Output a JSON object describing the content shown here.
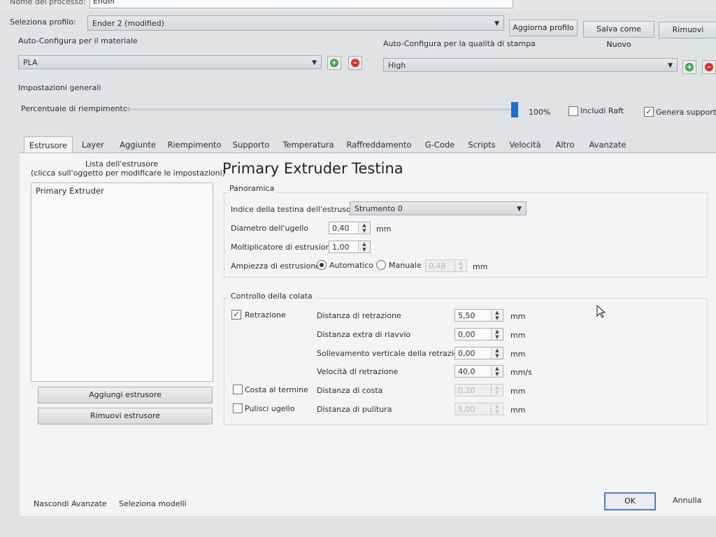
{
  "header": {
    "process_name_label": "Nome del processo:",
    "process_name_value": "Ender",
    "profile_label": "Seleziona profilo:",
    "profile_value": "Ender 2 (modified)",
    "update_profile": "Aggiorna profilo",
    "save_new": "Salva come Nuovo",
    "remove": "Rimuovi"
  },
  "material": {
    "label": "Auto-Configura per il materiale",
    "value": "PLA"
  },
  "quality": {
    "label": "Auto-Configura per la qualità di stampa",
    "value": "High"
  },
  "general": {
    "title": "Impostazioni generali",
    "infill_label": "Percentuale di riempimento:",
    "infill_value": "100%",
    "infill_fraction": 1.0,
    "raft_label": "Includi Raft",
    "raft_checked": false,
    "support_label": "Genera supporto",
    "support_checked": true
  },
  "tabs": [
    "Estrusore",
    "Layer",
    "Aggiunte",
    "Riempimento",
    "Supporto",
    "Temperatura",
    "Raffreddamento",
    "G-Code",
    "Scripts",
    "Velocità",
    "Altro",
    "Avanzate"
  ],
  "extruder_list": {
    "title": "Lista dell'estrusore",
    "subtitle": "(clicca sull'oggetto per modificare le impostazioni)",
    "items": [
      "Primary Extruder"
    ],
    "add_button": "Aggiungi estrusore",
    "remove_button": "Rimuovi estrusore"
  },
  "extruder": {
    "heading": "Primary Extruder Testina",
    "overview_title": "Panoramica",
    "head_index_label": "Indice della testina dell'estrusore",
    "head_index_value": "Strumento 0",
    "nozzle_label": "Diametro dell'ugello",
    "nozzle_value": "0,40",
    "nozzle_unit": "mm",
    "multiplier_label": "Moltiplicatore di estrusione",
    "multiplier_value": "1,00",
    "width_label": "Ampiezza di estrusione",
    "width_auto": "Automatico",
    "width_manual": "Manuale",
    "width_value": "0,48",
    "width_unit": "mm"
  },
  "ooze": {
    "title": "Controllo della colata",
    "retraction_label": "Retrazione",
    "retraction_checked": true,
    "coast_label": "Costa al termine",
    "coast_checked": false,
    "wipe_label": "Pulisci ugello",
    "wipe_checked": false,
    "rows": [
      {
        "label": "Distanza di retrazione",
        "value": "5,50",
        "unit": "mm"
      },
      {
        "label": "Distanza extra di riavvio",
        "value": "0,00",
        "unit": "mm"
      },
      {
        "label": "Sollevamento verticale della retrazione",
        "value": "0,00",
        "unit": "mm"
      },
      {
        "label": "Velocità di retrazione",
        "value": "40,0",
        "unit": "mm/s"
      },
      {
        "label": "Distanza di costa",
        "value": "0,20",
        "unit": "mm"
      },
      {
        "label": "Distanza di pulitura",
        "value": "5,00",
        "unit": "mm"
      }
    ]
  },
  "footer": {
    "hide_advanced": "Nascondi Avanzate",
    "select_models": "Seleziona modelli",
    "ok": "OK",
    "cancel": "Annulla"
  }
}
